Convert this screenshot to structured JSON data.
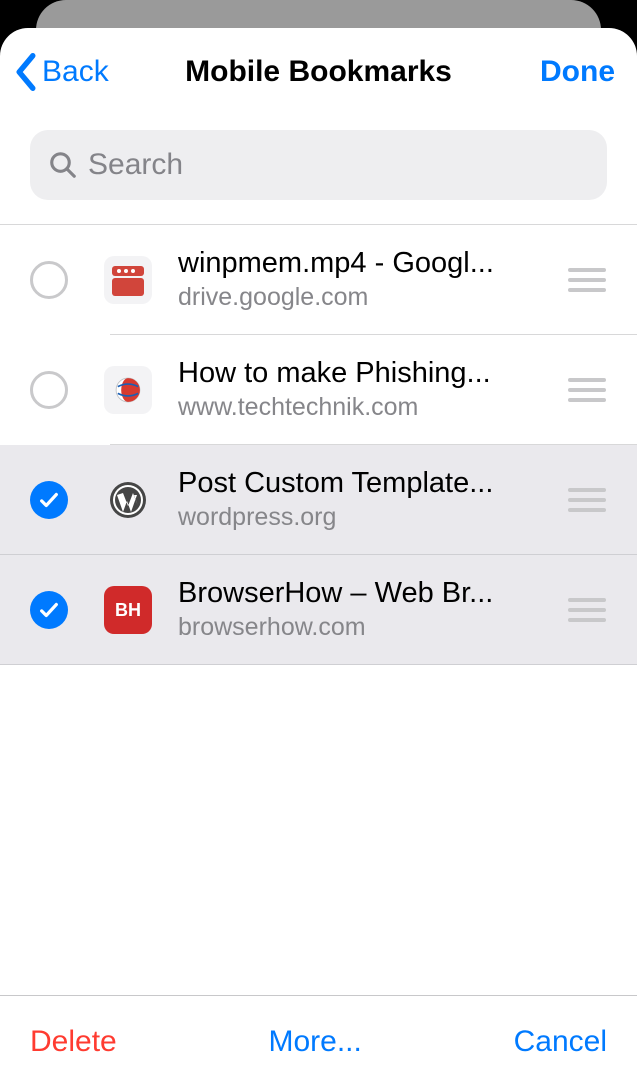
{
  "header": {
    "back_label": "Back",
    "title": "Mobile Bookmarks",
    "done_label": "Done"
  },
  "search": {
    "placeholder": "Search",
    "value": ""
  },
  "bookmarks": [
    {
      "selected": false,
      "icon": "drive-red-icon",
      "title": "winpmem.mp4 - Googl...",
      "url": "drive.google.com"
    },
    {
      "selected": false,
      "icon": "techtechnik-globe-icon",
      "title": "How to make Phishing...",
      "url": "www.techtechnik.com"
    },
    {
      "selected": true,
      "icon": "wordpress-icon",
      "title": "Post Custom Template...",
      "url": "wordpress.org"
    },
    {
      "selected": true,
      "icon": "browserhow-bh-icon",
      "title": "BrowserHow – Web Br...",
      "url": "browserhow.com"
    }
  ],
  "toolbar": {
    "delete_label": "Delete",
    "more_label": "More...",
    "cancel_label": "Cancel"
  }
}
